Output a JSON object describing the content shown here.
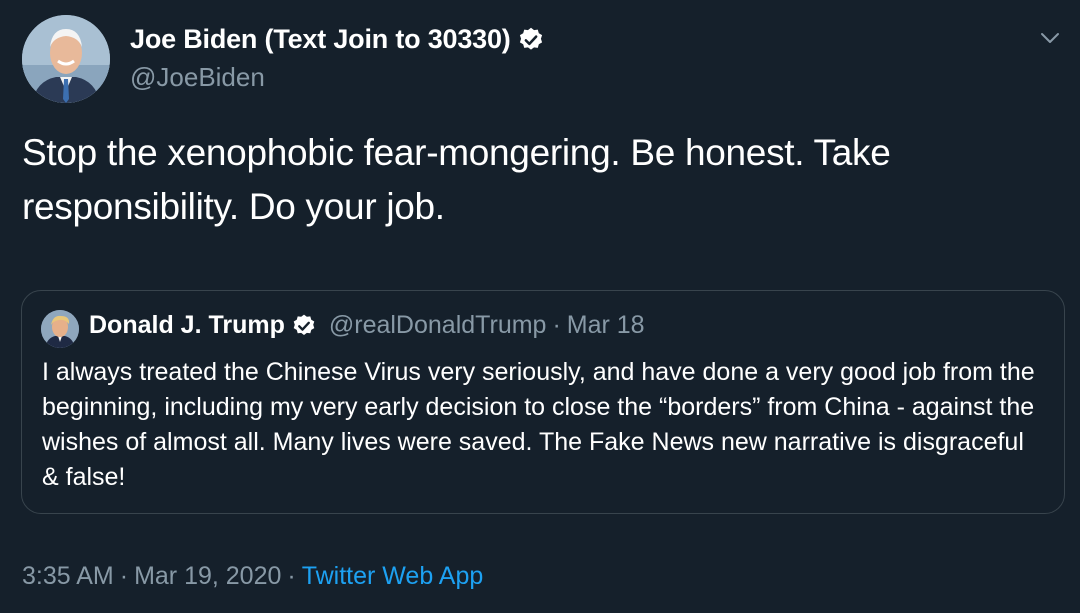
{
  "author": {
    "display_name": "Joe Biden (Text Join to 30330)",
    "handle": "@JoeBiden",
    "verified": true,
    "avatar": "profile-photo"
  },
  "tweet": {
    "text": "Stop the xenophobic fear-mongering. Be honest. Take responsibility. Do your job."
  },
  "quoted_tweet": {
    "display_name": "Donald J. Trump",
    "handle": "@realDonaldTrump",
    "separator": "·",
    "date": "Mar 18",
    "verified": true,
    "text": "I always treated the Chinese Virus very seriously, and have done a very good job from the beginning, including my very early decision to close the “borders” from China - against the wishes of almost all. Many lives were saved. The Fake News new narrative is disgraceful & false!"
  },
  "meta": {
    "time": "3:35 AM",
    "separator": "·",
    "date": "Mar 19, 2020",
    "source": "Twitter Web App"
  },
  "icons": {
    "verified": "verified-badge-icon",
    "menu": "chevron-down-icon"
  },
  "colors": {
    "background": "#15202b",
    "secondary_text": "#8899a6",
    "link": "#1da1f2",
    "border": "#38444d"
  }
}
